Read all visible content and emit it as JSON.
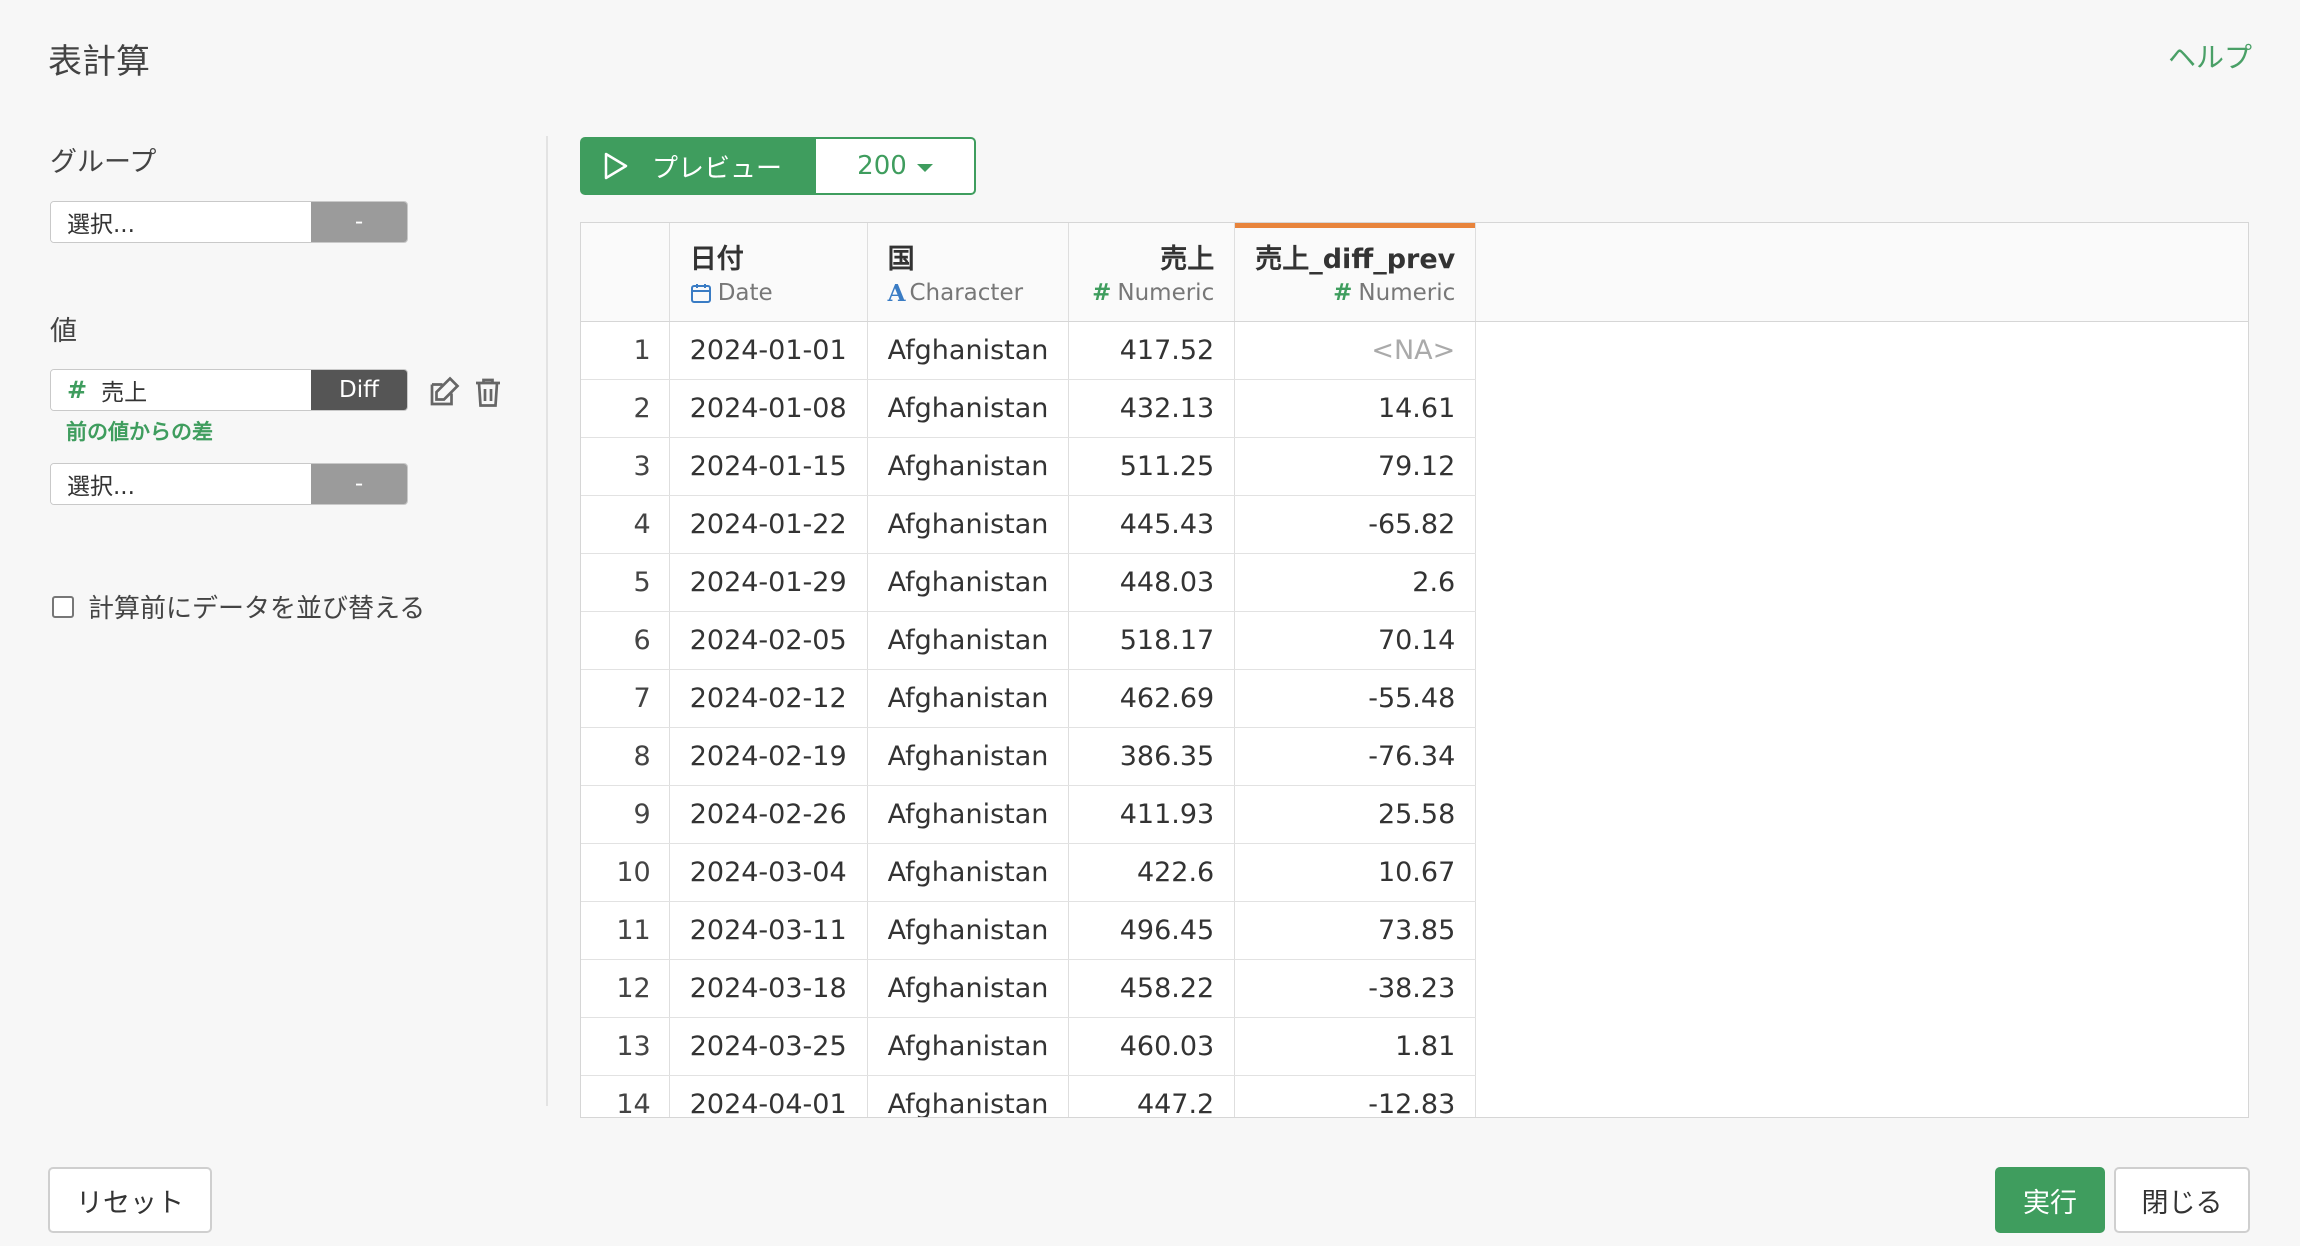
{
  "header": {
    "title": "表計算",
    "help": "ヘルプ"
  },
  "left": {
    "group_label": "グループ",
    "group_select": {
      "placeholder": "選択...",
      "button": "-"
    },
    "value_label": "値",
    "value_row": {
      "field": "売上",
      "button": "Diff",
      "caption": "前の値からの差"
    },
    "value_select2": {
      "placeholder": "選択...",
      "button": "-"
    },
    "sort_checkbox_label": "計算前にデータを並び替える",
    "sort_checked": false
  },
  "preview": {
    "button_label": "プレビュー",
    "count": "200"
  },
  "table": {
    "columns": [
      {
        "name": "",
        "type": ""
      },
      {
        "name": "日付",
        "type": "Date",
        "icon": "calendar-icon"
      },
      {
        "name": "国",
        "type": "Character",
        "icon": "character-a-icon"
      },
      {
        "name": "売上",
        "type": "Numeric",
        "icon": "hash-icon"
      },
      {
        "name": "売上_diff_prev",
        "type": "Numeric",
        "icon": "hash-icon",
        "accent": "#e8843c"
      }
    ],
    "rows": [
      [
        "1",
        "2024-01-01",
        "Afghanistan",
        "417.52",
        "<NA>"
      ],
      [
        "2",
        "2024-01-08",
        "Afghanistan",
        "432.13",
        "14.61"
      ],
      [
        "3",
        "2024-01-15",
        "Afghanistan",
        "511.25",
        "79.12"
      ],
      [
        "4",
        "2024-01-22",
        "Afghanistan",
        "445.43",
        "-65.82"
      ],
      [
        "5",
        "2024-01-29",
        "Afghanistan",
        "448.03",
        "2.6"
      ],
      [
        "6",
        "2024-02-05",
        "Afghanistan",
        "518.17",
        "70.14"
      ],
      [
        "7",
        "2024-02-12",
        "Afghanistan",
        "462.69",
        "-55.48"
      ],
      [
        "8",
        "2024-02-19",
        "Afghanistan",
        "386.35",
        "-76.34"
      ],
      [
        "9",
        "2024-02-26",
        "Afghanistan",
        "411.93",
        "25.58"
      ],
      [
        "10",
        "2024-03-04",
        "Afghanistan",
        "422.6",
        "10.67"
      ],
      [
        "11",
        "2024-03-11",
        "Afghanistan",
        "496.45",
        "73.85"
      ],
      [
        "12",
        "2024-03-18",
        "Afghanistan",
        "458.22",
        "-38.23"
      ],
      [
        "13",
        "2024-03-25",
        "Afghanistan",
        "460.03",
        "1.81"
      ],
      [
        "14",
        "2024-04-01",
        "Afghanistan",
        "447.2",
        "-12.83"
      ]
    ]
  },
  "footer": {
    "reset": "リセット",
    "run": "実行",
    "close": "閉じる"
  },
  "colors": {
    "accent_green": "#3f9d5e",
    "column_accent": "#e8843c",
    "char_icon": "#3a7cc4"
  }
}
